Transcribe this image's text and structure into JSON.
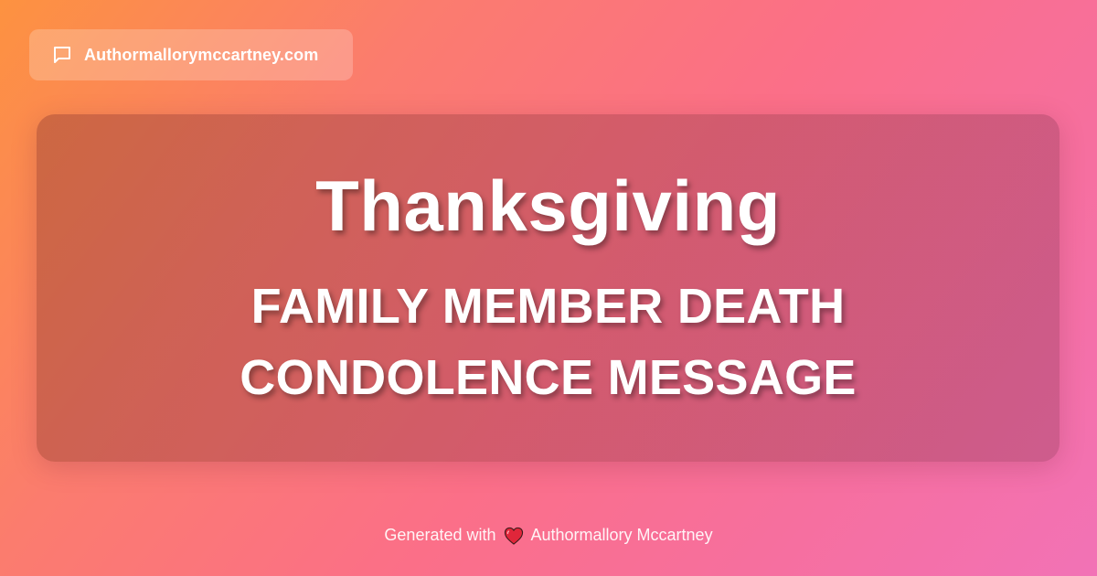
{
  "header": {
    "site_name": "Authormallorymccartney.com",
    "icon": "chat-bubble-icon"
  },
  "card": {
    "title": "Thanksgiving",
    "subtitle_line1": "FAMILY MEMBER DEATH",
    "subtitle_line2": "CONDOLENCE MESSAGE"
  },
  "footer": {
    "prefix": "Generated with",
    "icon": "heart-icon",
    "author": "Authormallory Mccartney"
  },
  "colors": {
    "gradient_start": "#fd9240",
    "gradient_end": "#f272b6",
    "text": "#ffffff",
    "heart": "#e0263a"
  }
}
